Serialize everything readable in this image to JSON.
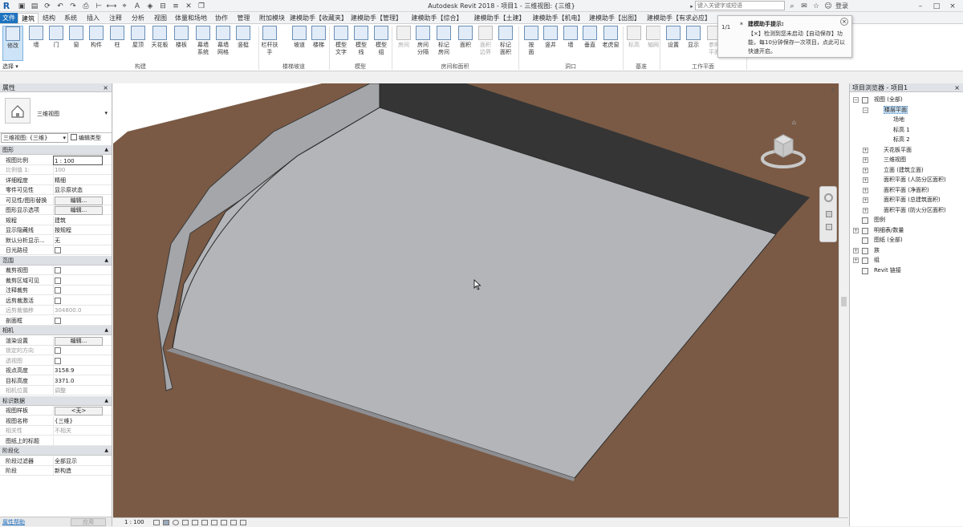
{
  "app": {
    "title": "Autodesk Revit 2018 -   项目1 - 三维视图: {三维}",
    "logo": "R",
    "search_placeholder": "键入关键字或短语",
    "login_label": "登录",
    "qat_icons": [
      "open-icon",
      "save-icon",
      "sync-icon",
      "undo-icon",
      "redo-icon",
      "print-icon",
      "measure-icon",
      "dimension-icon",
      "tag-icon",
      "text-icon",
      "3d-view-icon",
      "section-icon",
      "thin-lines-icon",
      "close-hidden-icon",
      "switch-windows-icon"
    ]
  },
  "tabs": [
    "文件",
    "建筑",
    "结构",
    "系统",
    "插入",
    "注释",
    "分析",
    "视图",
    "体量和场地",
    "协作",
    "管理",
    "附加模块",
    "建模助手【收藏夹】",
    "建模助手【管理】",
    "建模助手【综合】",
    "建模助手【土建】",
    "建模助手【机电】",
    "建模助手【出图】",
    "建模助手【有求必应】"
  ],
  "active_tab_index": 1,
  "ribbon": {
    "buttons": [
      {
        "label": "修改",
        "icon": "modify-arrow-icon",
        "active": true
      },
      {
        "label": "墙",
        "icon": "wall-icon"
      },
      {
        "label": "门",
        "icon": "door-icon"
      },
      {
        "label": "窗",
        "icon": "window-icon"
      },
      {
        "label": "构件",
        "icon": "component-icon"
      },
      {
        "label": "柱",
        "icon": "column-icon"
      },
      {
        "label": "屋顶",
        "icon": "roof-icon"
      },
      {
        "label": "天花板",
        "icon": "ceiling-icon"
      },
      {
        "label": "楼板",
        "icon": "floor-icon"
      },
      {
        "label": "幕墙\n系统",
        "icon": "curtain-system-icon"
      },
      {
        "label": "幕墙\n网格",
        "icon": "curtain-grid-icon"
      },
      {
        "label": "竖梃",
        "icon": "mullion-icon"
      },
      {
        "label": "栏杆扶手",
        "icon": "railing-icon"
      },
      {
        "label": "坡道",
        "icon": "ramp-icon"
      },
      {
        "label": "楼梯",
        "icon": "stair-icon"
      },
      {
        "label": "模型\n文字",
        "icon": "model-text-icon"
      },
      {
        "label": "模型\n线",
        "icon": "model-line-icon"
      },
      {
        "label": "模型\n组",
        "icon": "model-group-icon"
      },
      {
        "label": "房间",
        "icon": "room-icon",
        "disabled": true
      },
      {
        "label": "房间\n分隔",
        "icon": "room-separator-icon"
      },
      {
        "label": "标记\n房间",
        "icon": "tag-room-icon"
      },
      {
        "label": "面积",
        "icon": "area-icon"
      },
      {
        "label": "面积\n边界",
        "icon": "area-boundary-icon",
        "disabled": true
      },
      {
        "label": "标记\n面积",
        "icon": "tag-area-icon"
      },
      {
        "label": "按\n面",
        "icon": "by-face-icon"
      },
      {
        "label": "竖井",
        "icon": "shaft-icon"
      },
      {
        "label": "墙",
        "icon": "wall-opening-icon"
      },
      {
        "label": "垂直",
        "icon": "vertical-opening-icon"
      },
      {
        "label": "老虎窗",
        "icon": "dormer-icon"
      },
      {
        "label": "标高",
        "icon": "level-icon",
        "disabled": true
      },
      {
        "label": "轴网",
        "icon": "grid-icon",
        "disabled": true
      },
      {
        "label": "设置",
        "icon": "set-workplane-icon"
      },
      {
        "label": "显示",
        "icon": "show-workplane-icon"
      },
      {
        "label": "参照\n平面",
        "icon": "ref-plane-icon",
        "disabled": true
      }
    ],
    "panels": [
      "选择",
      "构建",
      "楼梯坡道",
      "模型",
      "房间和面积",
      "洞口",
      "基准",
      "工作平面"
    ],
    "select_label": "选择 ▾"
  },
  "tooltip": {
    "counter": "1/1",
    "title": "建模助手提示:",
    "body": "【×】检测到您未启动【自动保存】功能，每10分钟保存一次项目，点此可以快速开启。",
    "close": "×"
  },
  "properties": {
    "header": "属性",
    "type_name": "三维视图",
    "selector": "三维视图: {三维}",
    "edit_type": "编辑类型",
    "sections": [
      {
        "title": "图形",
        "rows": [
          {
            "k": "视图比例",
            "v": "1 : 100",
            "type": "field"
          },
          {
            "k": "比例值 1:",
            "v": "100",
            "dis": true
          },
          {
            "k": "详细程度",
            "v": "精细"
          },
          {
            "k": "零件可见性",
            "v": "显示原状态"
          },
          {
            "k": "可见性/图形替换",
            "v": "编辑...",
            "type": "btn"
          },
          {
            "k": "图形显示选项",
            "v": "编辑...",
            "type": "btn"
          },
          {
            "k": "规程",
            "v": "建筑"
          },
          {
            "k": "显示隐藏线",
            "v": "按规程"
          },
          {
            "k": "默认分析显示...",
            "v": "无"
          },
          {
            "k": "日光路径",
            "v": "",
            "type": "chk"
          }
        ]
      },
      {
        "title": "范围",
        "rows": [
          {
            "k": "裁剪视图",
            "v": "",
            "type": "chk"
          },
          {
            "k": "裁剪区域可见",
            "v": "",
            "type": "chk"
          },
          {
            "k": "注释裁剪",
            "v": "",
            "type": "chk"
          },
          {
            "k": "远剪裁激活",
            "v": "",
            "type": "chk"
          },
          {
            "k": "远剪裁偏移",
            "v": "304800.0",
            "dis": true
          },
          {
            "k": "剖面框",
            "v": "",
            "type": "chk"
          }
        ]
      },
      {
        "title": "相机",
        "rows": [
          {
            "k": "渲染设置",
            "v": "编辑...",
            "type": "btn"
          },
          {
            "k": "锁定的方向",
            "v": "",
            "type": "chk",
            "dis": true
          },
          {
            "k": "透视图",
            "v": "",
            "type": "chk",
            "dis": true
          },
          {
            "k": "视点高度",
            "v": "3158.9"
          },
          {
            "k": "目标高度",
            "v": "3371.0"
          },
          {
            "k": "相机位置",
            "v": "调整",
            "dis": true
          }
        ]
      },
      {
        "title": "标识数据",
        "rows": [
          {
            "k": "视图样板",
            "v": "<无>",
            "type": "btn"
          },
          {
            "k": "视图名称",
            "v": "{三维}"
          },
          {
            "k": "相关性",
            "v": "不相关",
            "dis": true
          },
          {
            "k": "图纸上的标题",
            "v": ""
          }
        ]
      },
      {
        "title": "阶段化",
        "rows": [
          {
            "k": "阶段过滤器",
            "v": "全部显示"
          },
          {
            "k": "阶段",
            "v": "新构造"
          }
        ]
      }
    ],
    "help_link": "属性帮助",
    "apply": "应用"
  },
  "browser": {
    "header": "项目浏览器 - 项目1",
    "items": [
      {
        "label": "视图 (全部)",
        "level": 0,
        "exp": "−",
        "icon": "views-icon"
      },
      {
        "label": "楼层平面",
        "level": 1,
        "exp": "−",
        "selected": true
      },
      {
        "label": "场地",
        "level": 2
      },
      {
        "label": "标高 1",
        "level": 2
      },
      {
        "label": "标高 2",
        "level": 2
      },
      {
        "label": "天花板平面",
        "level": 1,
        "exp": "+"
      },
      {
        "label": "三维视图",
        "level": 1,
        "exp": "+"
      },
      {
        "label": "立面 (建筑立面)",
        "level": 1,
        "exp": "+"
      },
      {
        "label": "面积平面 (人防分区面积)",
        "level": 1,
        "exp": "+"
      },
      {
        "label": "面积平面 (净面积)",
        "level": 1,
        "exp": "+"
      },
      {
        "label": "面积平面 (总建筑面积)",
        "level": 1,
        "exp": "+"
      },
      {
        "label": "面积平面 (防火分区面积)",
        "level": 1,
        "exp": "+"
      },
      {
        "label": "图例",
        "level": 0,
        "icon": "legend-icon"
      },
      {
        "label": "明细表/数量",
        "level": 0,
        "exp": "+",
        "icon": "schedule-icon"
      },
      {
        "label": "图纸 (全部)",
        "level": 0,
        "icon": "sheet-icon"
      },
      {
        "label": "族",
        "level": 0,
        "exp": "+",
        "icon": "family-icon"
      },
      {
        "label": "组",
        "level": 0,
        "exp": "+",
        "icon": "group-icon"
      },
      {
        "label": "Revit 链接",
        "level": 0,
        "icon": "link-icon"
      }
    ]
  },
  "status": {
    "scale": "1 : 100"
  },
  "colors": {
    "ground": "#7a5a45",
    "floor": "#b4b5b9",
    "wall_light": "#a5a6aa",
    "wall_dark": "#353535",
    "accent": "#1e73be"
  }
}
